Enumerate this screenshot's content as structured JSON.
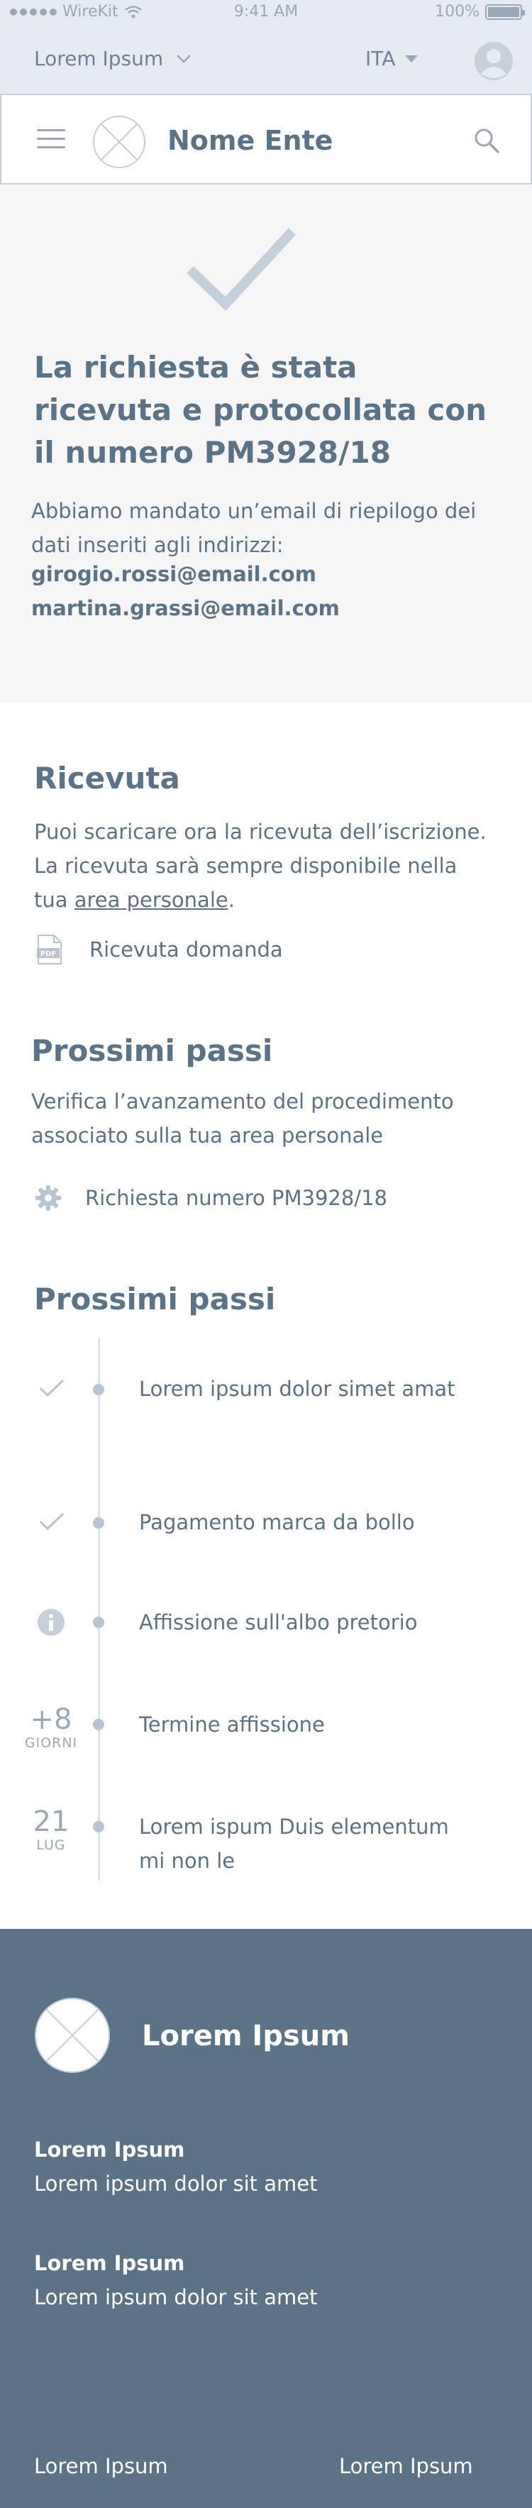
{
  "status_bar": {
    "carrier": "WireKit",
    "time": "9:41 AM",
    "battery": "100%"
  },
  "topbar": {
    "ente_label": "Lorem Ipsum",
    "language": "ITA"
  },
  "header": {
    "title": "Nome Ente"
  },
  "confirmation": {
    "title": "La richiesta è stata ricevuta e protocollata con il numero PM3928/18",
    "message": "Abbiamo mandato un’email di riepilogo dei dati inseriti agli indirizzi:",
    "emails": [
      "girogio.rossi@email.com",
      "martina.grassi@email.com"
    ]
  },
  "ricevuta": {
    "title": "Ricevuta",
    "text_before": "Puoi scaricare ora la ricevuta dell’iscrizione. La ricevuta sarà sempre disponibile nella tua",
    "link": "area personale",
    "text_after": ".",
    "download_label": "Ricevuta domanda",
    "pdf_icon_label": "PDF"
  },
  "prossimi_passi_1": {
    "title": "Prossimi passi",
    "text": "Verifica l’avanzamento del procedimento associato sulla tua area personale",
    "request_label": "Richiesta numero PM3928/18"
  },
  "prossimi_passi_2": {
    "title": "Prossimi passi",
    "steps": [
      {
        "marker": "check-icon",
        "text": "Lorem ipsum dolor simet amat"
      },
      {
        "marker": "check-icon",
        "text": "Pagamento marca da bollo"
      },
      {
        "marker": "info-icon",
        "text": "Affissione sull'albo pretorio"
      },
      {
        "marker_big": "+8",
        "marker_small": "GIORNI",
        "text": "Termine affissione"
      },
      {
        "marker_big": "21",
        "marker_small": "LUG",
        "text": "Lorem ispum Duis elementum mi non le"
      }
    ]
  },
  "footer": {
    "title": "Lorem Ipsum",
    "blocks": [
      {
        "heading": "Lorem Ipsum",
        "text": "Lorem ipsum dolor sit amet"
      },
      {
        "heading": "Lorem Ipsum",
        "text": "Lorem ipsum dolor sit amet"
      }
    ],
    "links": [
      "Lorem Ipsum",
      "Lorem Ipsum"
    ]
  },
  "colors": {
    "primary": "#5b7387",
    "muted": "#9aa9b7",
    "light_bg": "#e6ebf2",
    "panel_bg": "#f6f6f6"
  }
}
